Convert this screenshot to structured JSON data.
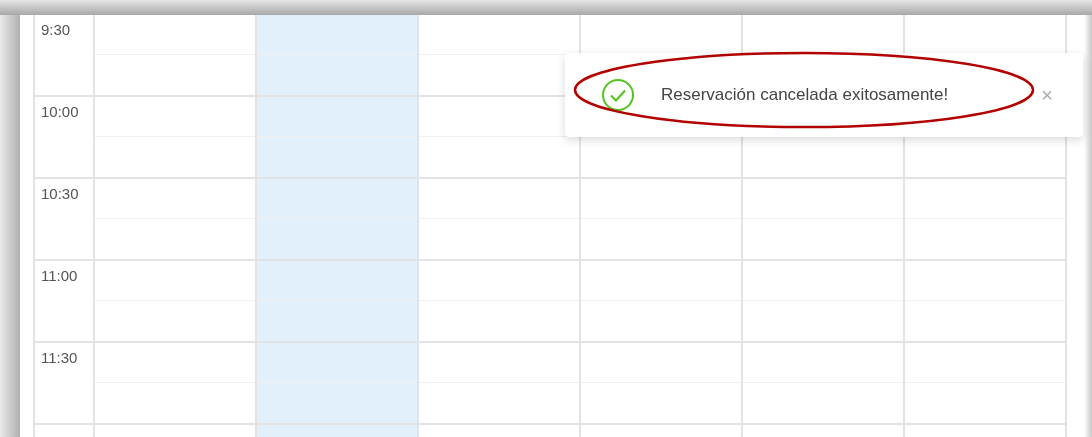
{
  "calendar": {
    "days": [
      {
        "selected": false
      },
      {
        "selected": true
      },
      {
        "selected": false
      },
      {
        "selected": false
      },
      {
        "selected": false
      },
      {
        "selected": false
      }
    ],
    "time_slots": [
      "9:30",
      "10:00",
      "10:30",
      "11:00",
      "11:30"
    ]
  },
  "toast": {
    "kind": "success",
    "message": "Reservación cancelada exitosamente!",
    "close": "×"
  }
}
